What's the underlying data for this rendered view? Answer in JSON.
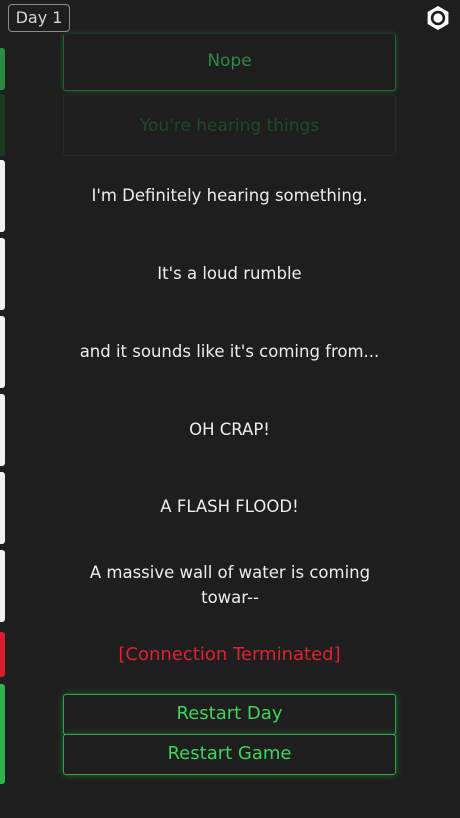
{
  "header": {
    "day_label": "Day 1",
    "settings_icon": "gear-icon"
  },
  "choices": {
    "nope": "Nope",
    "hearing": "You're hearing things"
  },
  "messages": [
    "I'm Definitely hearing something.",
    "It's a loud rumble",
    "and it sounds like it's coming from...",
    "OH CRAP!",
    "A FLASH FLOOD!",
    "A massive wall of water is coming towar--"
  ],
  "status": {
    "connection": "[Connection Terminated]"
  },
  "actions": {
    "restart_day": "Restart Day",
    "restart_game": "Restart Game"
  },
  "colors": {
    "background": "#1e1e1e",
    "accent_green": "#3dd45c",
    "alert_red": "#e2202e",
    "message_white": "#ededed"
  }
}
